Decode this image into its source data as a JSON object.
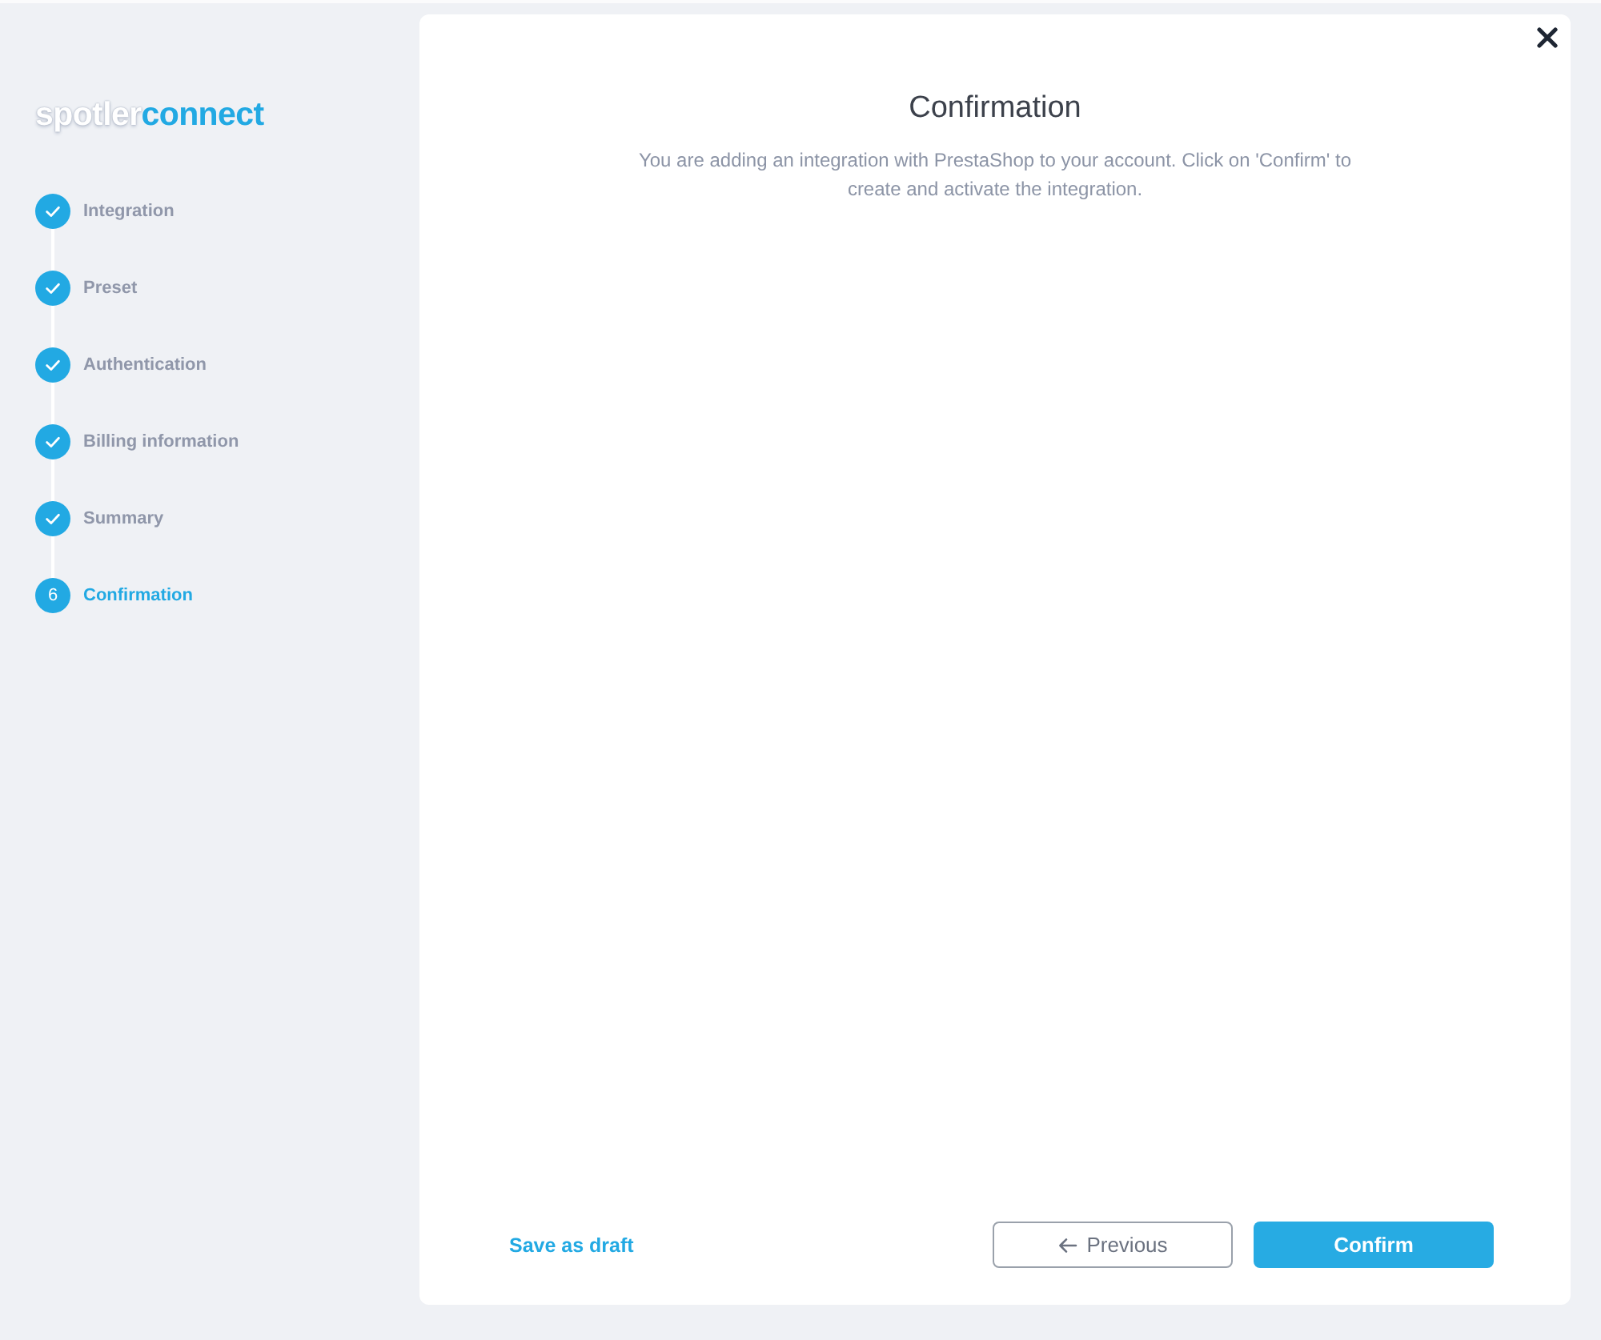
{
  "logo": {
    "part_1": "spotler",
    "part_2": "connect"
  },
  "steps": [
    {
      "label": "Integration",
      "completed": true,
      "selected": false
    },
    {
      "label": "Preset",
      "completed": true,
      "selected": false
    },
    {
      "label": "Authentication",
      "completed": true,
      "selected": false
    },
    {
      "label": "Billing information",
      "completed": true,
      "selected": false
    },
    {
      "label": "Summary",
      "completed": true,
      "selected": false
    },
    {
      "label": "Confirmation",
      "number": "6",
      "completed": false,
      "selected": true
    }
  ],
  "dialog": {
    "title": "Confirmation",
    "description": "You are adding an integration with PrestaShop to your account. Click on 'Confirm' to create and activate the integration."
  },
  "footer": {
    "save_draft": "Save as draft",
    "previous": "Previous",
    "confirm": "Confirm"
  }
}
